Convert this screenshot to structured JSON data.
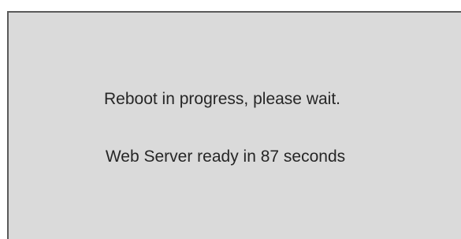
{
  "status": {
    "message": "Reboot in progress, please wait.",
    "countdown": "Web Server ready in 87 seconds",
    "seconds_remaining": 87
  },
  "colors": {
    "panel_background": "#dadada",
    "panel_border": "#5a5a5a",
    "text": "#262626"
  }
}
